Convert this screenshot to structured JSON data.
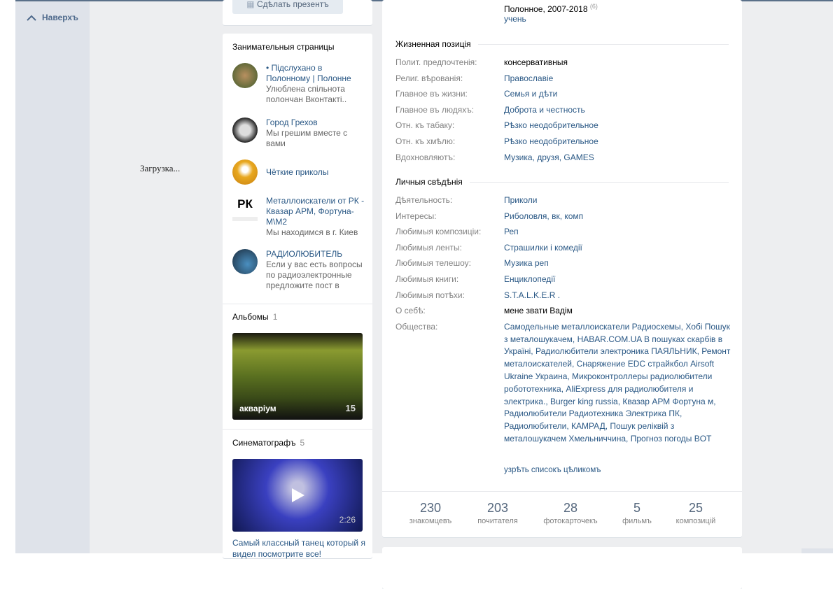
{
  "nav": {
    "up_label": "Наверхъ"
  },
  "loading": "Загрузка...",
  "left": {
    "present_button": "Сдѣлать презентъ",
    "pages_title": "Занимательныя страницы",
    "pages": [
      {
        "name": "• Підслухано в Полонному | Полонне",
        "desc": "Улюблена спільнота полончан Вконтакті.."
      },
      {
        "name": "Город Грехов",
        "desc": "Мы грешим вместе с вами"
      },
      {
        "name": "Чёткие приколы",
        "desc": ""
      },
      {
        "name": "Металлоискатели от РК - Квазар АРМ, Фортуна-М\\М2",
        "desc": "Мы находимся в г. Киев"
      },
      {
        "name": "РАДИОЛЮБИТЕЛЬ",
        "desc": "Если у вас есть вопросы по радиоэлектронные предложите пост в"
      }
    ],
    "pk_logo": "РК",
    "albums_title": "Альбомы",
    "albums_count": "1",
    "album": {
      "name": "акваріум",
      "count": "15"
    },
    "videos_title": "Синематографъ",
    "videos_count": "5",
    "video": {
      "duration": "2:26",
      "title": "Самый классный танец который я видел посмотрите все!"
    }
  },
  "main": {
    "edu_line": "Полонное, 2007-2018",
    "edu_sup": "(6)",
    "edu_role": "учень",
    "life_title": "Жизненная позиція",
    "life": [
      {
        "label": "Полит. предпочтенія:",
        "value": "консервативныя",
        "dark": true
      },
      {
        "label": "Религ. вѣрованія:",
        "value": "Православіе"
      },
      {
        "label": "Главное въ жизни:",
        "value": "Семья и дѣти"
      },
      {
        "label": "Главное въ людяхъ:",
        "value": "Доброта и честность"
      },
      {
        "label": "Отн. къ табаку:",
        "value": "Рѣзко неодобрительное"
      },
      {
        "label": "Отн. къ хмѣлю:",
        "value": "Рѣзко неодобрительное"
      },
      {
        "label": "Вдохновляютъ:",
        "value": "Музика, друзя, GAMES"
      }
    ],
    "personal_title": "Личныя свѣдѣнія",
    "personal": [
      {
        "label": "Дѣятельность:",
        "value": "Приколи"
      },
      {
        "label": "Интересы:",
        "value": "Риболовля, вк, комп"
      },
      {
        "label": "Любимыя композиціи:",
        "value": "Реп"
      },
      {
        "label": "Любимыя ленты:",
        "value": "Страшилки і комедії"
      },
      {
        "label": "Любимыя телешоу:",
        "value": "Музика реп"
      },
      {
        "label": "Любимыя книги:",
        "value": "Енциклопедії"
      },
      {
        "label": "Любимыя потѣхи:",
        "value": "S.T.A.L.K.E.R ."
      },
      {
        "label": "О себѣ:",
        "value": "мене звати Вадім",
        "dark": true
      },
      {
        "label": "Общества:",
        "value": "Самодельные металлоискатели Радиосхемы, Хобі Пошук з металошукачем, HABAR.COM.UA В пошуках скарбів в Україні, Радиолюбители электроника ПАЯЛЬНИК, Ремонт металоискателей, Снаряжение EDC страйкбол Airsoft Ukraine Украина, Микроконтроллеры радиолюбители робототехника, AliExpress для радиолюбителя и электрика., Burger king russia, Квазар АРМ Фортуна м, Радиолюбители Радиотехника Электрика ПК, Радиолюбители, КАМРАД, Пошук реліквій з металошукачем Хмельниччина, Прогноз погоды BOT"
      }
    ],
    "show_all": "узрѣть списокъ цѣликомъ",
    "stats": [
      {
        "num": "230",
        "label": "знакомцевъ"
      },
      {
        "num": "203",
        "label": "почитателя"
      },
      {
        "num": "28",
        "label": "фотокарточекъ"
      },
      {
        "num": "5",
        "label": "фильмъ"
      },
      {
        "num": "25",
        "label": "композицій"
      }
    ]
  }
}
